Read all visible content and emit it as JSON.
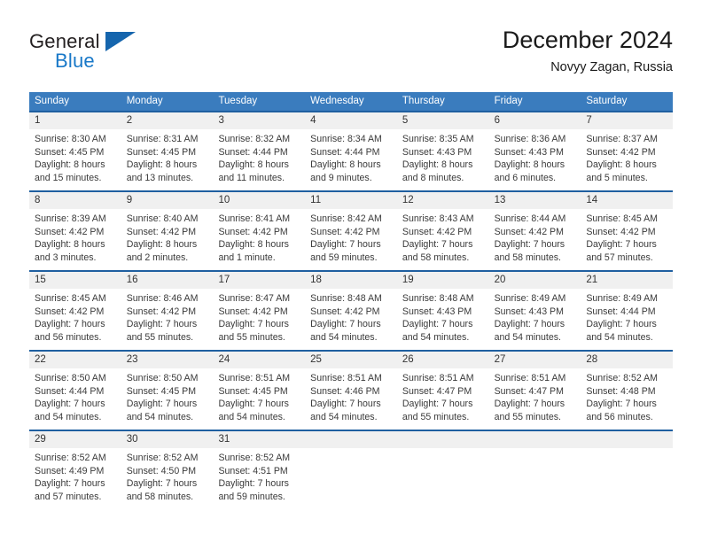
{
  "brand": {
    "name_part1": "General",
    "name_part2": "Blue",
    "triangle_icon": "triangle-logo-icon"
  },
  "header": {
    "title": "December 2024",
    "subtitle": "Novyy Zagan, Russia"
  },
  "calendar": {
    "weekday_headers": [
      "Sunday",
      "Monday",
      "Tuesday",
      "Wednesday",
      "Thursday",
      "Friday",
      "Saturday"
    ],
    "weeks": [
      [
        {
          "day": "1",
          "lines": [
            "Sunrise: 8:30 AM",
            "Sunset: 4:45 PM",
            "Daylight: 8 hours",
            "and 15 minutes."
          ]
        },
        {
          "day": "2",
          "lines": [
            "Sunrise: 8:31 AM",
            "Sunset: 4:45 PM",
            "Daylight: 8 hours",
            "and 13 minutes."
          ]
        },
        {
          "day": "3",
          "lines": [
            "Sunrise: 8:32 AM",
            "Sunset: 4:44 PM",
            "Daylight: 8 hours",
            "and 11 minutes."
          ]
        },
        {
          "day": "4",
          "lines": [
            "Sunrise: 8:34 AM",
            "Sunset: 4:44 PM",
            "Daylight: 8 hours",
            "and 9 minutes."
          ]
        },
        {
          "day": "5",
          "lines": [
            "Sunrise: 8:35 AM",
            "Sunset: 4:43 PM",
            "Daylight: 8 hours",
            "and 8 minutes."
          ]
        },
        {
          "day": "6",
          "lines": [
            "Sunrise: 8:36 AM",
            "Sunset: 4:43 PM",
            "Daylight: 8 hours",
            "and 6 minutes."
          ]
        },
        {
          "day": "7",
          "lines": [
            "Sunrise: 8:37 AM",
            "Sunset: 4:42 PM",
            "Daylight: 8 hours",
            "and 5 minutes."
          ]
        }
      ],
      [
        {
          "day": "8",
          "lines": [
            "Sunrise: 8:39 AM",
            "Sunset: 4:42 PM",
            "Daylight: 8 hours",
            "and 3 minutes."
          ]
        },
        {
          "day": "9",
          "lines": [
            "Sunrise: 8:40 AM",
            "Sunset: 4:42 PM",
            "Daylight: 8 hours",
            "and 2 minutes."
          ]
        },
        {
          "day": "10",
          "lines": [
            "Sunrise: 8:41 AM",
            "Sunset: 4:42 PM",
            "Daylight: 8 hours",
            "and 1 minute."
          ]
        },
        {
          "day": "11",
          "lines": [
            "Sunrise: 8:42 AM",
            "Sunset: 4:42 PM",
            "Daylight: 7 hours",
            "and 59 minutes."
          ]
        },
        {
          "day": "12",
          "lines": [
            "Sunrise: 8:43 AM",
            "Sunset: 4:42 PM",
            "Daylight: 7 hours",
            "and 58 minutes."
          ]
        },
        {
          "day": "13",
          "lines": [
            "Sunrise: 8:44 AM",
            "Sunset: 4:42 PM",
            "Daylight: 7 hours",
            "and 58 minutes."
          ]
        },
        {
          "day": "14",
          "lines": [
            "Sunrise: 8:45 AM",
            "Sunset: 4:42 PM",
            "Daylight: 7 hours",
            "and 57 minutes."
          ]
        }
      ],
      [
        {
          "day": "15",
          "lines": [
            "Sunrise: 8:45 AM",
            "Sunset: 4:42 PM",
            "Daylight: 7 hours",
            "and 56 minutes."
          ]
        },
        {
          "day": "16",
          "lines": [
            "Sunrise: 8:46 AM",
            "Sunset: 4:42 PM",
            "Daylight: 7 hours",
            "and 55 minutes."
          ]
        },
        {
          "day": "17",
          "lines": [
            "Sunrise: 8:47 AM",
            "Sunset: 4:42 PM",
            "Daylight: 7 hours",
            "and 55 minutes."
          ]
        },
        {
          "day": "18",
          "lines": [
            "Sunrise: 8:48 AM",
            "Sunset: 4:42 PM",
            "Daylight: 7 hours",
            "and 54 minutes."
          ]
        },
        {
          "day": "19",
          "lines": [
            "Sunrise: 8:48 AM",
            "Sunset: 4:43 PM",
            "Daylight: 7 hours",
            "and 54 minutes."
          ]
        },
        {
          "day": "20",
          "lines": [
            "Sunrise: 8:49 AM",
            "Sunset: 4:43 PM",
            "Daylight: 7 hours",
            "and 54 minutes."
          ]
        },
        {
          "day": "21",
          "lines": [
            "Sunrise: 8:49 AM",
            "Sunset: 4:44 PM",
            "Daylight: 7 hours",
            "and 54 minutes."
          ]
        }
      ],
      [
        {
          "day": "22",
          "lines": [
            "Sunrise: 8:50 AM",
            "Sunset: 4:44 PM",
            "Daylight: 7 hours",
            "and 54 minutes."
          ]
        },
        {
          "day": "23",
          "lines": [
            "Sunrise: 8:50 AM",
            "Sunset: 4:45 PM",
            "Daylight: 7 hours",
            "and 54 minutes."
          ]
        },
        {
          "day": "24",
          "lines": [
            "Sunrise: 8:51 AM",
            "Sunset: 4:45 PM",
            "Daylight: 7 hours",
            "and 54 minutes."
          ]
        },
        {
          "day": "25",
          "lines": [
            "Sunrise: 8:51 AM",
            "Sunset: 4:46 PM",
            "Daylight: 7 hours",
            "and 54 minutes."
          ]
        },
        {
          "day": "26",
          "lines": [
            "Sunrise: 8:51 AM",
            "Sunset: 4:47 PM",
            "Daylight: 7 hours",
            "and 55 minutes."
          ]
        },
        {
          "day": "27",
          "lines": [
            "Sunrise: 8:51 AM",
            "Sunset: 4:47 PM",
            "Daylight: 7 hours",
            "and 55 minutes."
          ]
        },
        {
          "day": "28",
          "lines": [
            "Sunrise: 8:52 AM",
            "Sunset: 4:48 PM",
            "Daylight: 7 hours",
            "and 56 minutes."
          ]
        }
      ],
      [
        {
          "day": "29",
          "lines": [
            "Sunrise: 8:52 AM",
            "Sunset: 4:49 PM",
            "Daylight: 7 hours",
            "and 57 minutes."
          ]
        },
        {
          "day": "30",
          "lines": [
            "Sunrise: 8:52 AM",
            "Sunset: 4:50 PM",
            "Daylight: 7 hours",
            "and 58 minutes."
          ]
        },
        {
          "day": "31",
          "lines": [
            "Sunrise: 8:52 AM",
            "Sunset: 4:51 PM",
            "Daylight: 7 hours",
            "and 59 minutes."
          ]
        },
        {
          "day": "",
          "lines": []
        },
        {
          "day": "",
          "lines": []
        },
        {
          "day": "",
          "lines": []
        },
        {
          "day": "",
          "lines": []
        }
      ]
    ]
  },
  "colors": {
    "header_blue": "#3a7cbe",
    "rule_blue": "#1f5fa0",
    "daynum_band": "#f0f0f0",
    "brand_blue": "#1878c8",
    "logo_triangle": "#1565ad"
  }
}
